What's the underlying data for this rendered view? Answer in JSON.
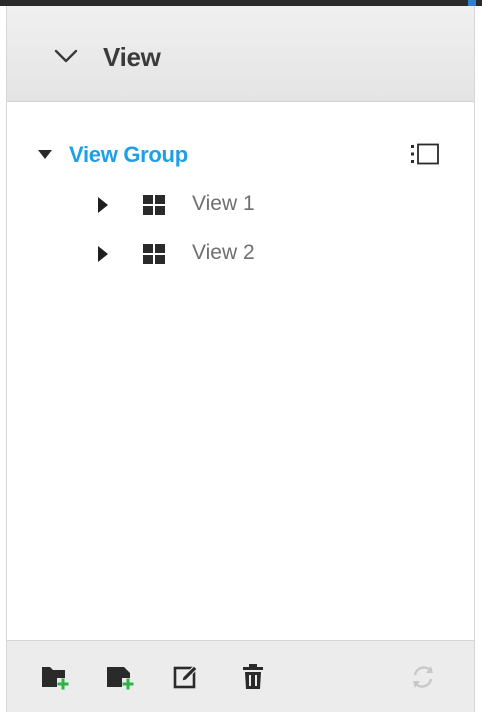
{
  "panel": {
    "title": "View"
  },
  "tree": {
    "group_label": "View Group",
    "items": [
      {
        "label": "View 1"
      },
      {
        "label": "View 2"
      }
    ]
  },
  "icons": {
    "header": "chevron-down-icon",
    "group": "caret-down-icon",
    "group_action": "list-panel-icon",
    "item_expand": "caret-right-icon",
    "item_type": "grid-view-icon",
    "footer": [
      "add-folder-icon",
      "add-view-icon",
      "edit-icon",
      "trash-icon",
      "refresh-icon"
    ]
  },
  "colors": {
    "accent": "#1fa0e6",
    "add_green": "#2db34a",
    "icon_dark": "#2a2a2a",
    "disabled": "#c8c8c8"
  }
}
